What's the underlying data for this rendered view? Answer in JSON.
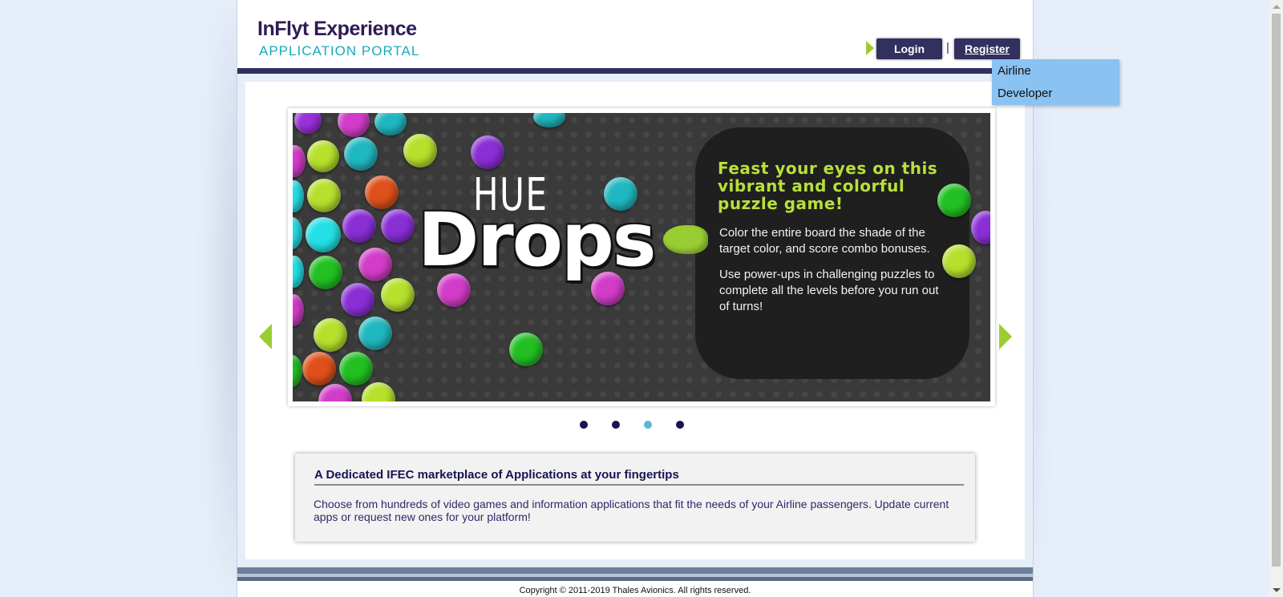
{
  "header": {
    "logo_title": "InFlyt Experience",
    "logo_subtitle": "APPLICATION PORTAL",
    "login_label": "Login",
    "separator": "|",
    "register_label": "Register"
  },
  "register_dropdown": {
    "items": [
      "Airline",
      "Developer"
    ]
  },
  "carousel": {
    "slide": {
      "logo_small": "HUE",
      "logo_big": "Drops",
      "heading": "Feast your eyes on this vibrant and colorful puzzle game!",
      "paragraphs": [
        "Color the entire board the shade of the target color, and score combo bonuses.",
        "Use power-ups in challenging puzzles to complete all the levels before you run out of turns!"
      ]
    },
    "dot_count": 4,
    "active_dot": 3,
    "colors": {
      "accent": "#9acd32",
      "dot": "#161451",
      "dot_active": "#5cb8cc"
    }
  },
  "info": {
    "title": "A Dedicated IFEC marketplace of Applications at your fingertips",
    "text": "Choose from hundreds of video games and information applications that fit the needs of your Airline passengers. Update current apps or request new ones for your platform!"
  },
  "footer": {
    "copyright": "Copyright © 2011-2019 Thales Avionics. All rights reserved."
  },
  "colors": {
    "brand_navy": "#31305f",
    "brand_teal": "#19a9bd",
    "dropdown_bg": "#8ac2f2",
    "page_bg": "#e6eef9"
  }
}
